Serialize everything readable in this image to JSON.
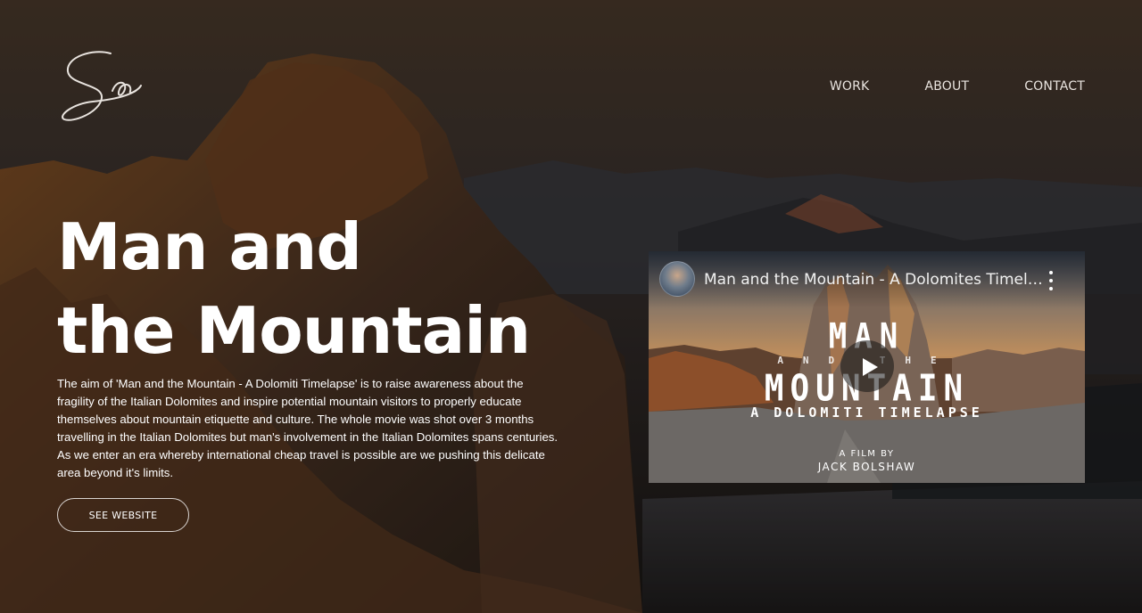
{
  "nav": {
    "items": [
      {
        "label": "WORK"
      },
      {
        "label": "ABOUT"
      },
      {
        "label": "CONTACT"
      }
    ]
  },
  "hero": {
    "title_line1": "Man and",
    "title_line2": "the Mountain",
    "description": "The aim of 'Man and the Mountain - A Dolomiti Timelapse' is to raise awareness about the fragility of the Italian Dolomites and inspire potential mountain visitors to properly educate themselves about mountain etiquette and culture. The whole movie was shot over 3 months travelling in the Italian Dolomites but man's involvement in the Italian Dolomites spans centuries. As we enter an era whereby international cheap travel is possible are we pushing this delicate area beyond it's limits.",
    "cta_label": "SEE WEBSITE"
  },
  "video": {
    "title": "Man and the Mountain - A Dolomites Timelapse",
    "poster": {
      "line1": "MAN",
      "line2": "AND THE",
      "line3": "MOUNTAIN",
      "line4": "A DOLOMITI TIMELAPSE",
      "film_by": "A FILM BY",
      "author": "JACK BOLSHAW"
    },
    "icons": {
      "play": "play-icon",
      "menu": "more-vertical-icon"
    }
  },
  "colors": {
    "background": "#2a2522",
    "accent_orange": "#b0602a",
    "text": "#ffffff"
  }
}
